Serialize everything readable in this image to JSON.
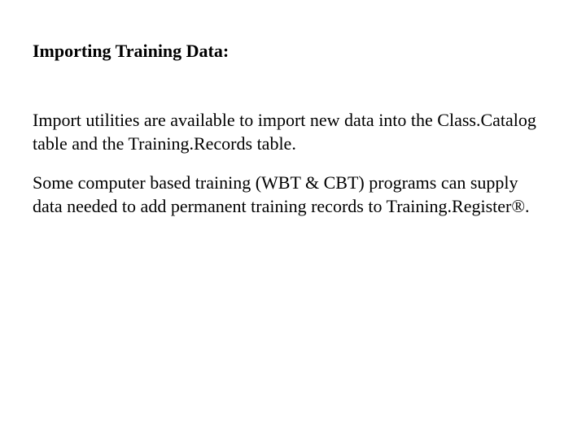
{
  "heading": "Importing Training Data:",
  "paragraphs": [
    "Import utilities are available to import new data into the Class.Catalog table and the Training.Records table.",
    "Some computer based training (WBT & CBT) programs can supply data needed to add permanent training records to Training.Register®."
  ]
}
